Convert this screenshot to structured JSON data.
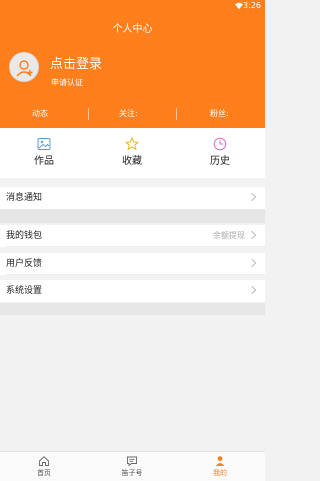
{
  "status_bar": {
    "time": "3:26"
  },
  "header": {
    "title": "个人中心",
    "login_label": "点击登录",
    "apply_label": "申请认证",
    "stats": [
      {
        "label": "动态"
      },
      {
        "label": "关注:"
      },
      {
        "label": "粉丝:"
      }
    ]
  },
  "tiles": [
    {
      "label": "作品",
      "icon": "picture-icon",
      "color": "#5b9bd5"
    },
    {
      "label": "收藏",
      "icon": "star-icon",
      "color": "#f1b51c"
    },
    {
      "label": "历史",
      "icon": "clock-icon",
      "color": "#e56ab8"
    }
  ],
  "menu": {
    "notifications": {
      "label": "消息通知"
    },
    "wallet": {
      "label": "我的钱包",
      "right": "余额提现"
    },
    "feedback": {
      "label": "用户反馈"
    },
    "settings": {
      "label": "系统设置"
    }
  },
  "tabbar": [
    {
      "label": "首页",
      "icon": "home-icon"
    },
    {
      "label": "笛子号",
      "icon": "chat-icon"
    },
    {
      "label": "我的",
      "icon": "person-icon",
      "active": true
    }
  ],
  "colors": {
    "accent": "#ff7f1d"
  }
}
